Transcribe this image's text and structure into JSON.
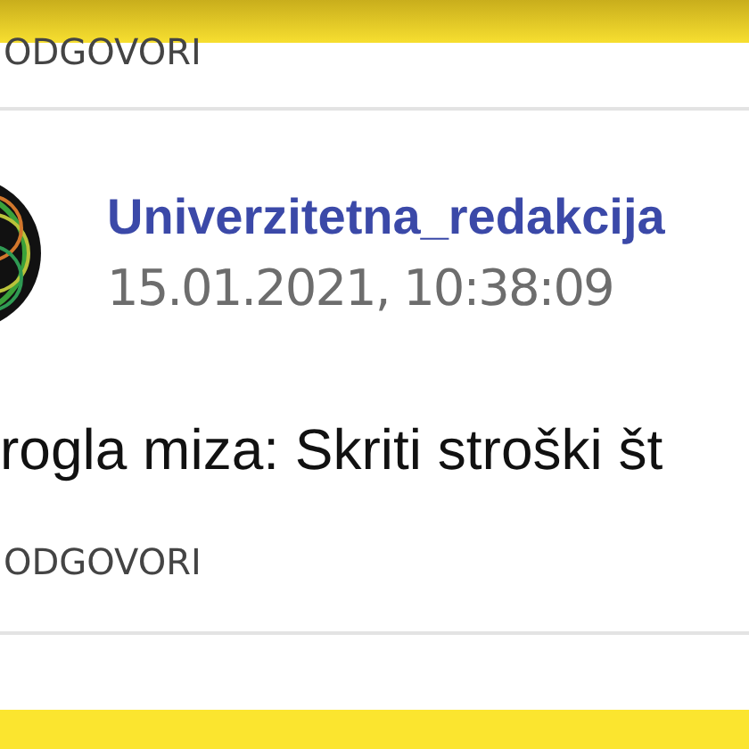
{
  "previous_comment": {
    "reply_label": "ODGOVORI"
  },
  "comment": {
    "author": "Univerzitetna_redakcija",
    "timestamp": "15.01.2021, 10:38:09",
    "text": "rogla miza: Skriti stroški št",
    "reply_label": "ODGOVORI"
  }
}
